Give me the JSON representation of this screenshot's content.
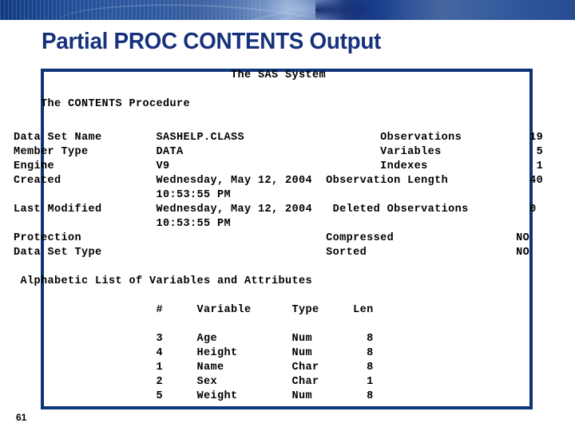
{
  "slide": {
    "title": "Partial PROC CONTENTS Output",
    "page_number": "61",
    "title_color": "#16327d",
    "border_color": "#0d3378",
    "banner_color": "#1e4a93"
  },
  "output": {
    "system_header": "The SAS System",
    "procedure_header": "The CONTENTS Procedure",
    "attributes": {
      "left": [
        {
          "label": "Data Set Name",
          "value": "SASHELP.CLASS"
        },
        {
          "label": "Member Type",
          "value": "DATA"
        },
        {
          "label": "Engine",
          "value": "V9"
        },
        {
          "label": "Created",
          "value": "Wednesday, May 12, 2004"
        },
        {
          "label": "",
          "value": "10:53:55 PM"
        },
        {
          "label": "Last Modified",
          "value": "Wednesday, May 12, 2004"
        },
        {
          "label": "",
          "value": "10:53:55 PM"
        },
        {
          "label": "Protection",
          "value": ""
        },
        {
          "label": "Data Set Type",
          "value": ""
        }
      ],
      "right": [
        {
          "label": "Observations",
          "value": "19"
        },
        {
          "label": "Variables",
          "value": "5"
        },
        {
          "label": "Indexes",
          "value": "1"
        },
        {
          "label": "Observation Length",
          "value": "40"
        },
        {
          "label": "Deleted Observations",
          "value": "0"
        },
        {
          "label": "Compressed",
          "value": "NO"
        },
        {
          "label": "Sorted",
          "value": "NO"
        }
      ]
    },
    "variables_section": {
      "heading": "Alphabetic List of Variables and Attributes",
      "columns": [
        "#",
        "Variable",
        "Type",
        "Len"
      ],
      "rows": [
        {
          "num": "3",
          "variable": "Age",
          "type": "Num",
          "len": "8"
        },
        {
          "num": "4",
          "variable": "Height",
          "type": "Num",
          "len": "8"
        },
        {
          "num": "1",
          "variable": "Name",
          "type": "Char",
          "len": "8"
        },
        {
          "num": "2",
          "variable": "Sex",
          "type": "Char",
          "len": "1"
        },
        {
          "num": "5",
          "variable": "Weight",
          "type": "Num",
          "len": "8"
        }
      ]
    },
    "lines": [
      "                                  The SAS System",
      "",
      "      The CONTENTS Procedure",
      "",
      "  Data Set Name        SASHELP.CLASS                    Observations          19",
      "  Member Type          DATA                             Variables              5",
      "  Engine               V9                               Indexes                1",
      "  Created              Wednesday, May 12, 2004  Observation Length            40",
      "                       10:53:55 PM",
      "  Last Modified        Wednesday, May 12, 2004   Deleted Observations         0",
      "                       10:53:55 PM",
      "  Protection                                    Compressed                  NO",
      "  Data Set Type                                 Sorted                      NO",
      "",
      "   Alphabetic List of Variables and Attributes",
      "",
      "                       #     Variable      Type     Len",
      "",
      "                       3     Age           Num        8",
      "                       4     Height        Num        8",
      "                       1     Name          Char       8",
      "                       2     Sex           Char       1",
      "                       5     Weight        Num        8"
    ]
  }
}
